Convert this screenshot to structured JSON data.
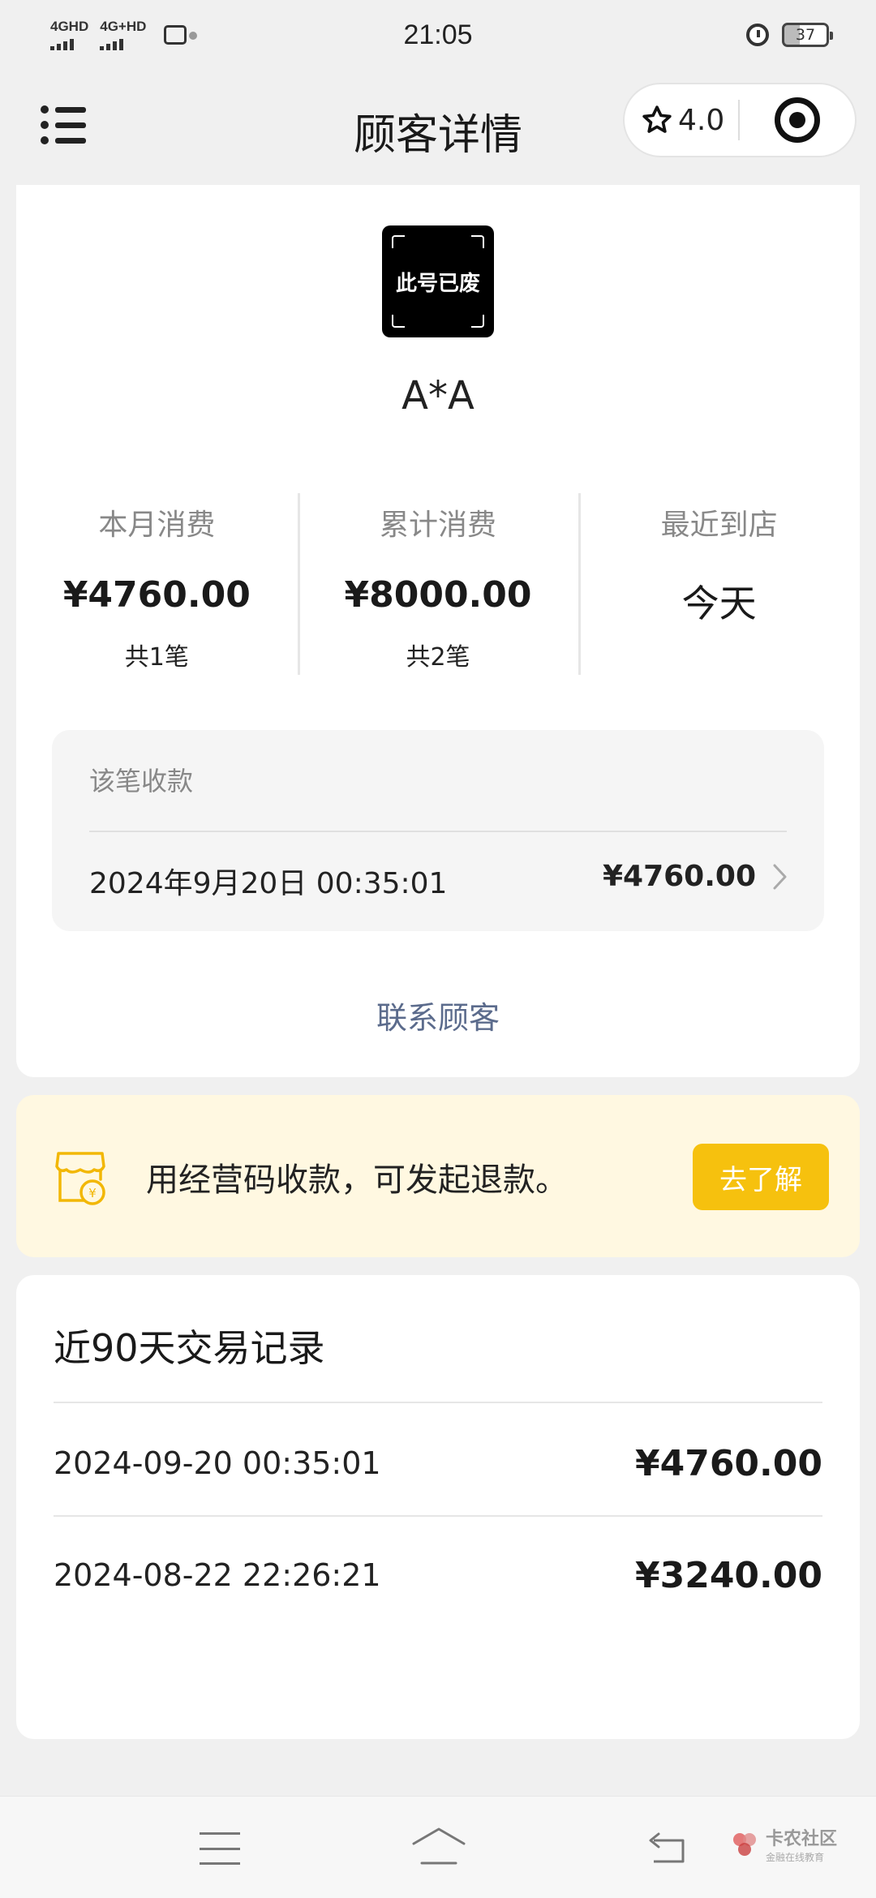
{
  "status_bar": {
    "sig1_label": "4GHD",
    "sig2_label": "4G+HD",
    "time": "21:05",
    "battery": "37"
  },
  "nav": {
    "title": "顾客详情",
    "rating": "4.0"
  },
  "customer": {
    "avatar_text": "此号已废",
    "name": "A*A"
  },
  "stats": [
    {
      "label": "本月消费",
      "value": "¥4760.00",
      "count": "共1笔"
    },
    {
      "label": "累计消费",
      "value": "¥8000.00",
      "count": "共2笔"
    },
    {
      "label": "最近到店",
      "value": "今天",
      "count": ""
    }
  ],
  "payment": {
    "label": "该笔收款",
    "time": "2024年9月20日 00:35:01",
    "amount": "¥4760.00"
  },
  "contact_label": "联系顾客",
  "notice": {
    "text": "用经营码收款，可发起退款。",
    "button": "去了解"
  },
  "transactions": {
    "title": "近90天交易记录",
    "rows": [
      {
        "time": "2024-09-20 00:35:01",
        "amount": "¥4760.00"
      },
      {
        "time": "2024-08-22 22:26:21",
        "amount": "¥3240.00"
      }
    ]
  },
  "watermark": {
    "title": "卡农社区",
    "subtitle": "金融在线教育"
  },
  "colors": {
    "accent_yellow": "#f6c10e",
    "notice_bg": "#fff8e1",
    "link_blue": "#5b6b8c"
  }
}
